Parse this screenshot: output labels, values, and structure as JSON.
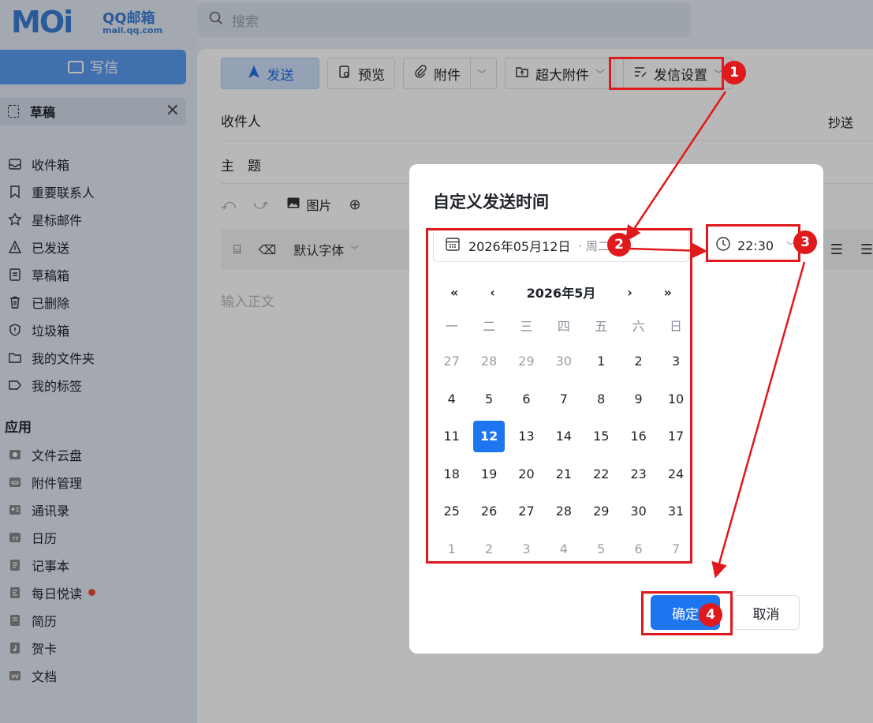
{
  "logo": {
    "brand": "QQ邮箱",
    "domain": "mail.qq.com"
  },
  "search": {
    "placeholder": "搜索"
  },
  "sidebar": {
    "compose": "写信",
    "draft_tab": "草稿",
    "folders": [
      {
        "label": "收件箱",
        "icon": "inbox-icon"
      },
      {
        "label": "重要联系人",
        "icon": "bookmark-icon"
      },
      {
        "label": "星标邮件",
        "icon": "star-icon"
      },
      {
        "label": "已发送",
        "icon": "sent-icon"
      },
      {
        "label": "草稿箱",
        "icon": "draft-icon"
      },
      {
        "label": "已删除",
        "icon": "trash-icon"
      },
      {
        "label": "垃圾箱",
        "icon": "shield-icon"
      },
      {
        "label": "我的文件夹",
        "icon": "folder-icon"
      },
      {
        "label": "我的标签",
        "icon": "tag-icon"
      }
    ],
    "apps_title": "应用",
    "apps": [
      {
        "label": "文件云盘",
        "icon": "cloud-drive-icon"
      },
      {
        "label": "附件管理",
        "icon": "attachment-manage-icon"
      },
      {
        "label": "通讯录",
        "icon": "contacts-icon"
      },
      {
        "label": "日历",
        "icon": "calendar-icon"
      },
      {
        "label": "记事本",
        "icon": "notepad-icon"
      },
      {
        "label": "每日悦读",
        "icon": "reading-icon",
        "dot": true
      },
      {
        "label": "简历",
        "icon": "resume-icon"
      },
      {
        "label": "贺卡",
        "icon": "card-icon"
      },
      {
        "label": "文档",
        "icon": "document-icon"
      }
    ]
  },
  "toolbar": {
    "send": "发送",
    "preview": "预览",
    "attach": "附件",
    "big_attach": "超大附件",
    "send_settings": "发信设置"
  },
  "compose": {
    "to_label": "收件人",
    "cc_label": "抄送",
    "subject_label": "主　题",
    "image_label": "图片",
    "font_label": "默认字体",
    "body_placeholder": "输入正文"
  },
  "modal": {
    "title": "自定义发送时间",
    "date_value": "2026年05月12日",
    "weekday": "· 周二",
    "time_value": "22:30",
    "month_label": "2026年5月",
    "nav_prev_year": "«",
    "nav_prev_month": "‹",
    "nav_next_month": "›",
    "nav_next_year": "»",
    "weekdays": [
      "一",
      "二",
      "三",
      "四",
      "五",
      "六",
      "日"
    ],
    "days": [
      [
        "27",
        "28",
        "29",
        "30",
        "1",
        "2",
        "3"
      ],
      [
        "4",
        "5",
        "6",
        "7",
        "8",
        "9",
        "10"
      ],
      [
        "11",
        "12",
        "13",
        "14",
        "15",
        "16",
        "17"
      ],
      [
        "18",
        "19",
        "20",
        "21",
        "22",
        "23",
        "24"
      ],
      [
        "25",
        "26",
        "27",
        "28",
        "29",
        "30",
        "31"
      ],
      [
        "1",
        "2",
        "3",
        "4",
        "5",
        "6",
        "7"
      ]
    ],
    "selected_day": "12",
    "confirm": "确定",
    "cancel": "取消"
  },
  "annotations": {
    "colors": {
      "highlight": "#e0191c"
    },
    "steps": [
      "1",
      "2",
      "3",
      "4"
    ]
  }
}
